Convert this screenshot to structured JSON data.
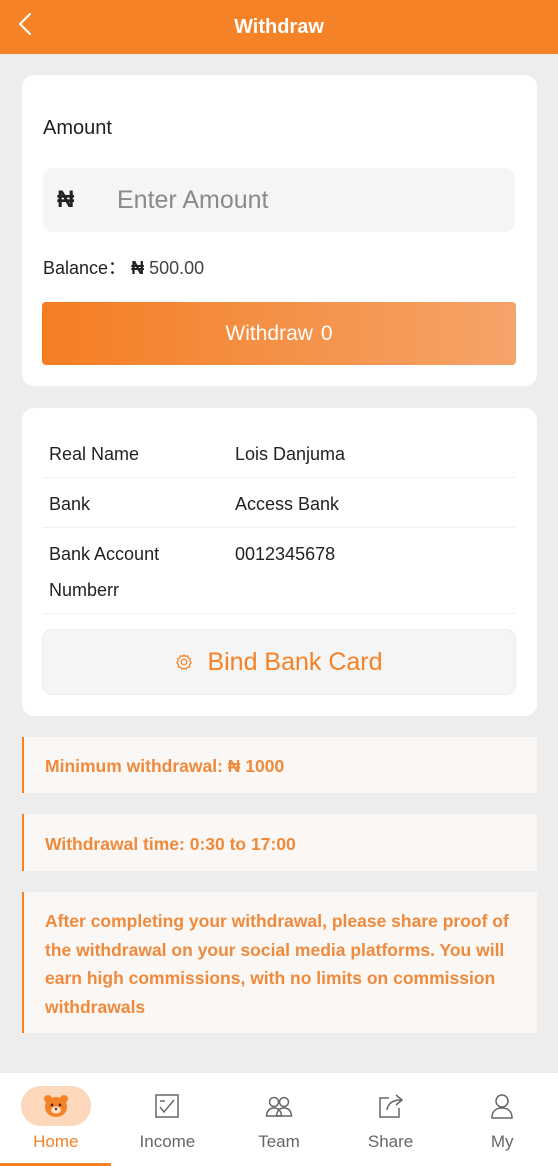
{
  "header": {
    "title": "Withdraw"
  },
  "amount": {
    "label": "Amount",
    "currency": "₦",
    "placeholder": "Enter Amount",
    "balance_label": "Balance：",
    "balance_currency": "₦",
    "balance_value": "500.00",
    "button_label": "Withdraw",
    "button_value": "0"
  },
  "bank": {
    "rows": [
      {
        "label": "Real Name",
        "value": "Lois Danjuma"
      },
      {
        "label": "Bank",
        "value": "Access Bank"
      },
      {
        "label": "Bank Account Numberr",
        "value": "0012345678"
      }
    ],
    "bind_label": "Bind Bank Card"
  },
  "notices": [
    "Minimum withdrawal: ₦ 1000",
    "Withdrawal time: 0:30 to 17:00",
    "After completing your withdrawal, please share proof of the withdrawal on your social media platforms. You will earn high commissions, with no limits on commission withdrawals"
  ],
  "tabs": [
    {
      "label": "Home",
      "icon": "home-bear-icon",
      "active": true
    },
    {
      "label": "Income",
      "icon": "income-icon",
      "active": false
    },
    {
      "label": "Team",
      "icon": "team-icon",
      "active": false
    },
    {
      "label": "Share",
      "icon": "share-icon",
      "active": false
    },
    {
      "label": "My",
      "icon": "user-icon",
      "active": false
    }
  ],
  "colors": {
    "accent": "#f58226",
    "notice_text": "#ef8a3c",
    "background": "#ededed"
  }
}
